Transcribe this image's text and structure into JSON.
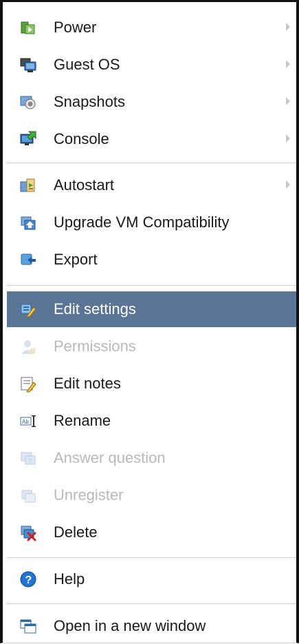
{
  "menu": {
    "power": {
      "label": "Power"
    },
    "guest_os": {
      "label": "Guest OS"
    },
    "snapshots": {
      "label": "Snapshots"
    },
    "console": {
      "label": "Console"
    },
    "autostart": {
      "label": "Autostart"
    },
    "upgrade": {
      "label": "Upgrade VM Compatibility"
    },
    "export": {
      "label": "Export"
    },
    "edit_settings": {
      "label": "Edit settings"
    },
    "permissions": {
      "label": "Permissions"
    },
    "edit_notes": {
      "label": "Edit notes"
    },
    "rename": {
      "label": "Rename"
    },
    "answer_question": {
      "label": "Answer question"
    },
    "unregister": {
      "label": "Unregister"
    },
    "delete": {
      "label": "Delete"
    },
    "help": {
      "label": "Help"
    },
    "open_new_window": {
      "label": "Open in a new window"
    }
  },
  "icons": {
    "power": "power-icon",
    "guest_os": "guest-os-icon",
    "snapshots": "snapshots-icon",
    "console": "console-icon",
    "autostart": "autostart-icon",
    "upgrade": "upgrade-icon",
    "export": "export-icon",
    "edit_settings": "edit-settings-icon",
    "permissions": "permissions-icon",
    "edit_notes": "edit-notes-icon",
    "rename": "rename-icon",
    "answer_question": "answer-question-icon",
    "unregister": "unregister-icon",
    "delete": "delete-icon",
    "help": "help-icon",
    "open_new_window": "open-new-window-icon"
  },
  "colors": {
    "highlight": "#5a7596",
    "disabled_text": "#b9b9b9",
    "separator": "#cfcfcf"
  }
}
